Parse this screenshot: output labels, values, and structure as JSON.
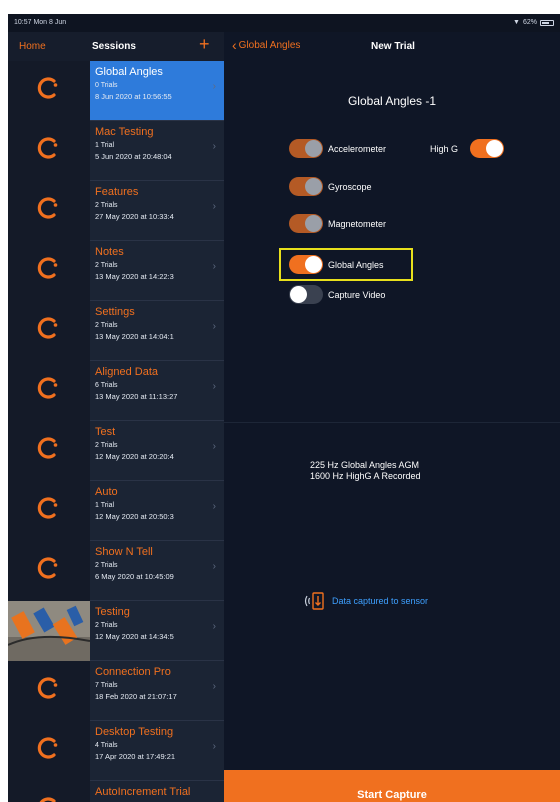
{
  "status_bar": {
    "time": "10:57  Mon 8 Jun",
    "battery": "62%"
  },
  "sidebar": {
    "home_label": "Home",
    "title": "Sessions",
    "add_label": "+",
    "sessions": [
      {
        "name": "Global Angles",
        "trials": "0 Trials",
        "date": "8 Jun 2020 at 10:56:55",
        "selected": true,
        "thumb": "logo"
      },
      {
        "name": "Mac Testing",
        "trials": "1 Trial",
        "date": "5 Jun 2020 at 20:48:04",
        "thumb": "logo"
      },
      {
        "name": "Features",
        "trials": "2 Trials",
        "date": "27 May 2020 at 10:33:4",
        "thumb": "logo"
      },
      {
        "name": "Notes",
        "trials": "2 Trials",
        "date": "13 May 2020 at 14:22:3",
        "thumb": "logo"
      },
      {
        "name": "Settings",
        "trials": "2 Trials",
        "date": "13 May 2020 at 14:04:1",
        "thumb": "logo"
      },
      {
        "name": "Aligned Data",
        "trials": "6 Trials",
        "date": "13 May 2020 at 11:13:27",
        "thumb": "logo"
      },
      {
        "name": "Test",
        "trials": "2 Trials",
        "date": "12 May 2020 at 20:20:4",
        "thumb": "logo"
      },
      {
        "name": "Auto",
        "trials": "1 Trial",
        "date": "12 May 2020 at 20:50:3",
        "thumb": "logo"
      },
      {
        "name": "Show N Tell",
        "trials": "2 Trials",
        "date": "6 May 2020 at 10:45:09",
        "thumb": "logo"
      },
      {
        "name": "Testing",
        "trials": "2 Trials",
        "date": "12 May 2020 at 14:34:5",
        "thumb": "photo"
      },
      {
        "name": "Connection Pro",
        "trials": "7 Trials",
        "date": "18 Feb 2020 at 21:07:17",
        "thumb": "logo"
      },
      {
        "name": "Desktop Testing",
        "trials": "4 Trials",
        "date": "17 Apr 2020 at 17:49:21",
        "thumb": "logo"
      },
      {
        "name": "AutoIncrement Trial",
        "trials": "",
        "date": "",
        "thumb": "logo"
      }
    ]
  },
  "detail": {
    "back_label": "Global Angles",
    "title": "New Trial",
    "trial_name": "Global Angles -1",
    "sensors": {
      "accelerometer": "Accelerometer",
      "high_g": "High G",
      "gyroscope": "Gyroscope",
      "magnetometer": "Magnetometer",
      "global_angles": "Global Angles",
      "capture_video": "Capture Video"
    },
    "summary_line1": "225 Hz Global Angles AGM",
    "summary_line2": "1600 Hz HighG A Recorded",
    "captured_text": "Data captured to sensor",
    "start_capture": "Start Capture"
  },
  "colors": {
    "accent": "#f0701f",
    "selected": "#2e7bdb",
    "link": "#3ea0ff",
    "highlight": "#e8e01c"
  }
}
